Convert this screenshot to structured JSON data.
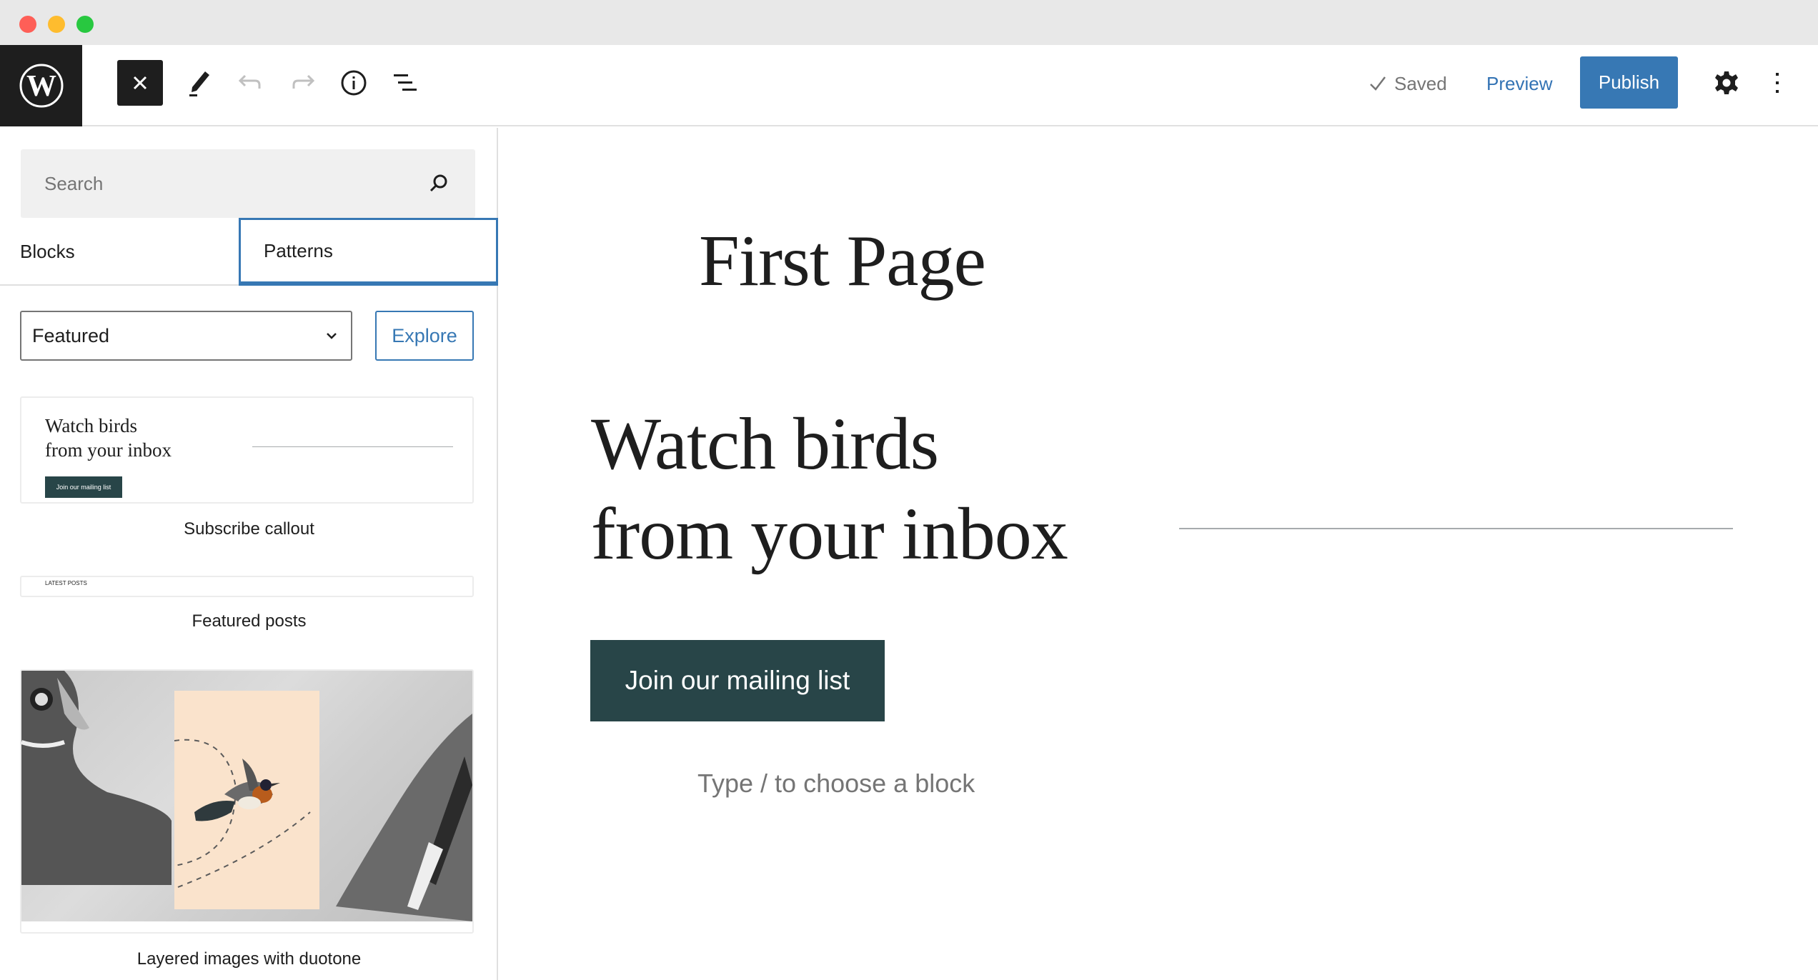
{
  "window": {
    "controls": [
      "close",
      "minimize",
      "maximize"
    ]
  },
  "header": {
    "logo": "wordpress-logo",
    "tools": [
      {
        "name": "close-inserter",
        "icon": "close-icon"
      },
      {
        "name": "tools",
        "icon": "pencil-icon"
      },
      {
        "name": "undo",
        "icon": "undo-icon"
      },
      {
        "name": "redo",
        "icon": "redo-icon"
      },
      {
        "name": "details",
        "icon": "info-icon"
      },
      {
        "name": "list-view",
        "icon": "list-view-icon"
      }
    ],
    "saved_label": "Saved",
    "preview_label": "Preview",
    "publish_label": "Publish",
    "accent_color": "#3778b4"
  },
  "sidebar": {
    "search_placeholder": "Search",
    "tabs": [
      {
        "label": "Blocks",
        "active": false
      },
      {
        "label": "Patterns",
        "active": true
      }
    ],
    "category_select": "Featured",
    "explore_label": "Explore",
    "patterns": [
      {
        "label": "Subscribe callout",
        "preview_heading_line1": "Watch birds",
        "preview_heading_line2": "from your inbox",
        "preview_button": "Join our mailing list"
      },
      {
        "label": "Featured posts",
        "preview_heading": "LATEST POSTS"
      },
      {
        "label": "Layered images with duotone"
      }
    ]
  },
  "canvas": {
    "page_title": "First Page",
    "heading_line1": "Watch birds",
    "heading_line2": "from your inbox",
    "button_label": "Join our mailing list",
    "button_color": "#284548",
    "block_placeholder": "Type / to choose a block"
  }
}
